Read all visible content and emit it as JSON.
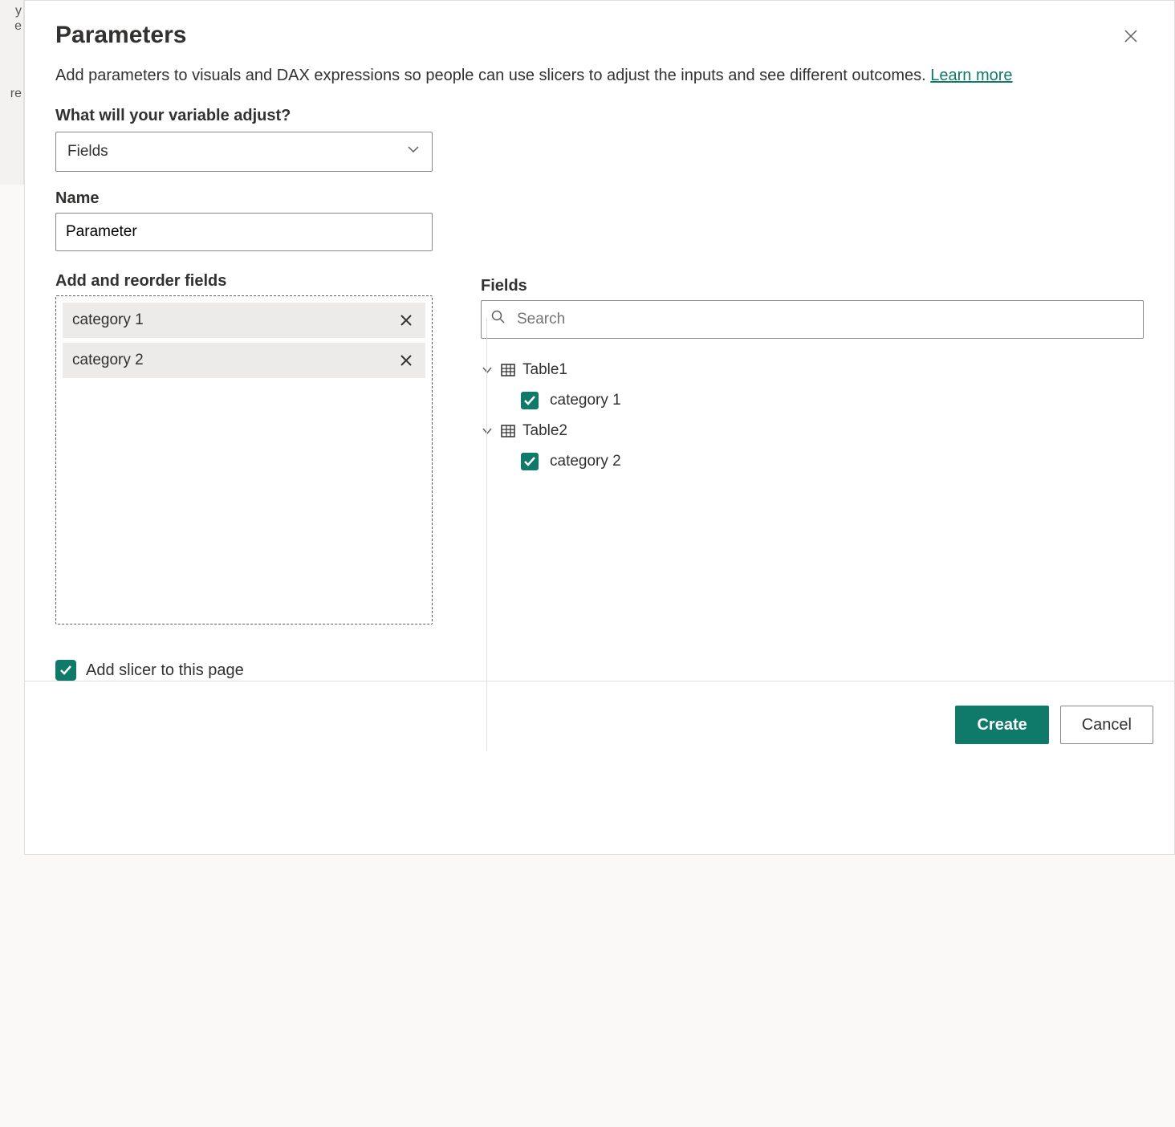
{
  "dialog": {
    "title": "Parameters",
    "description_pre": "Add parameters to visuals and DAX expressions so people can use slicers to adjust the inputs and see different outcomes. ",
    "learn_more": "Learn more"
  },
  "left": {
    "adjust_label": "What will your variable adjust?",
    "adjust_value": "Fields",
    "name_label": "Name",
    "name_value": "Parameter",
    "reorder_label": "Add and reorder fields",
    "chips": [
      {
        "label": "category 1"
      },
      {
        "label": "category 2"
      }
    ],
    "add_slicer_label": "Add slicer to this page",
    "add_slicer_checked": true
  },
  "right": {
    "fields_label": "Fields",
    "search_placeholder": "Search",
    "tables": [
      {
        "name": "Table1",
        "fields": [
          {
            "name": "category 1",
            "checked": true
          }
        ]
      },
      {
        "name": "Table2",
        "fields": [
          {
            "name": "category 2",
            "checked": true
          }
        ]
      }
    ]
  },
  "footer": {
    "create": "Create",
    "cancel": "Cancel"
  }
}
